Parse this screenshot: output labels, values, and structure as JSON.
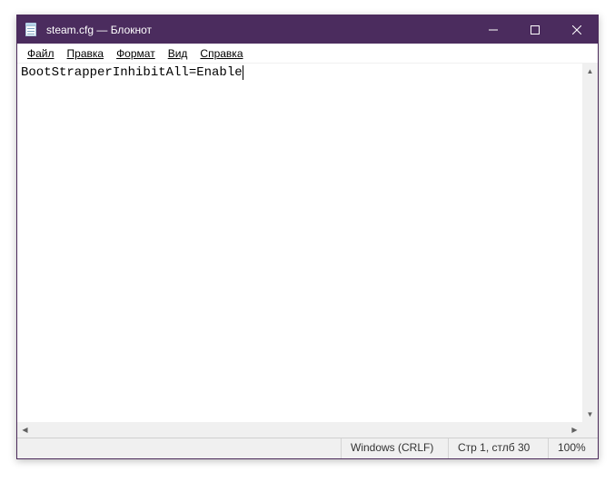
{
  "titlebar": {
    "title": "steam.cfg — Блокнот"
  },
  "menu": {
    "file": "Файл",
    "edit": "Правка",
    "format": "Формат",
    "view": "Вид",
    "help": "Справка"
  },
  "editor": {
    "content": "BootStrapperInhibitAll=Enable"
  },
  "statusbar": {
    "encoding": "Windows (CRLF)",
    "position": "Стр 1, стлб 30",
    "zoom": "100%"
  }
}
